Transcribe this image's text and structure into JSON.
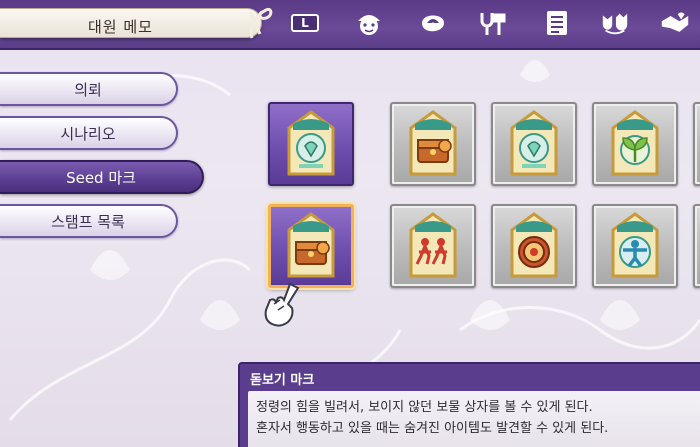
{
  "header": {
    "title": "대원 메모",
    "l_button_label": "L",
    "icons": [
      "l-button-icon",
      "face-icon",
      "pouch-icon",
      "tools-icon",
      "list-icon",
      "pets-icon",
      "handshake-icon"
    ]
  },
  "menu": {
    "items": [
      {
        "label": "의뢰",
        "active": false
      },
      {
        "label": "시나리오",
        "active": false
      },
      {
        "label": "Seed 마크",
        "active": true
      },
      {
        "label": "스탬프 목록",
        "active": false
      }
    ]
  },
  "marks": {
    "rows": [
      [
        {
          "emblem": "heart-leaf",
          "state": "owned",
          "selected": false
        },
        {
          "emblem": "treasure-chest",
          "state": "locked",
          "selected": false
        },
        {
          "emblem": "heart-leaf",
          "state": "locked",
          "selected": false
        },
        {
          "emblem": "sprout",
          "state": "locked",
          "selected": false
        }
      ],
      [
        {
          "emblem": "treasure-chest",
          "state": "owned",
          "selected": true
        },
        {
          "emblem": "runners",
          "state": "locked",
          "selected": false
        },
        {
          "emblem": "compass-wheel",
          "state": "locked",
          "selected": false
        },
        {
          "emblem": "person",
          "state": "locked",
          "selected": false
        }
      ]
    ]
  },
  "info": {
    "title": "돋보기 마크",
    "lines": [
      "정령의 힘을 빌려서, 보이지 않던 보물 상자를 볼 수 있게 된다.",
      "혼자서 행동하고 있을 때는 숨겨진 아이템도 발견할 수 있게 된다."
    ]
  },
  "colors": {
    "accent": "#5a3a86",
    "selected_border": "#f1b25a"
  }
}
